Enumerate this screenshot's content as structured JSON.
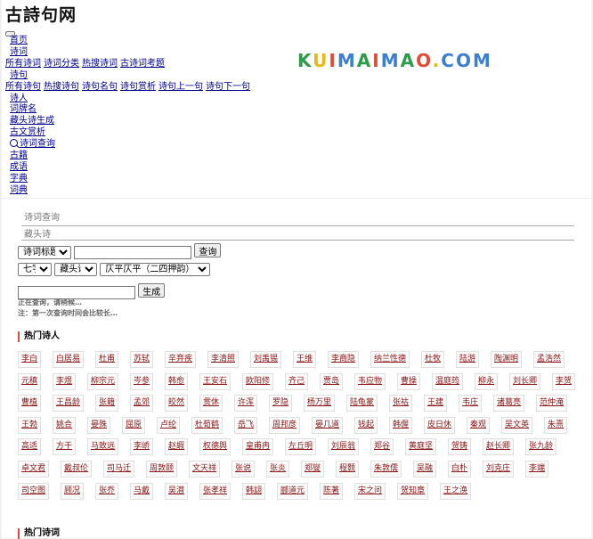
{
  "site": {
    "logo_text": "古詩句网",
    "brand": {
      "k": "K",
      "u": "U",
      "i": "I",
      "m": "M",
      "a": "A",
      "o": "O",
      "dot": ".",
      "com": "COM"
    }
  },
  "nav": {
    "home": "首页",
    "poems": "诗词",
    "poem_sub": [
      "所有诗词",
      "诗词分类",
      "热搜诗词",
      "古诗词考题"
    ],
    "lines": "诗句",
    "lines_sub": [
      "所有诗句",
      "热搜诗句",
      "诗句名句",
      "诗句赏析",
      "诗句上一句",
      "诗句下一句"
    ],
    "items": [
      "诗人",
      "词牌名",
      "藏头诗生成",
      "古文赏析"
    ],
    "search": "诗词查询",
    "items2": [
      "古籍",
      "成语",
      "字典",
      "词典"
    ]
  },
  "tabs": [
    "诗词查询",
    "藏头诗"
  ],
  "search": {
    "field_select": "诗词标题",
    "query_value": "",
    "query_button": "查询"
  },
  "acrostic": {
    "length_select": "七字",
    "type_select": "藏头诗",
    "rhyme_select": "仄平仄平（二四押韵）",
    "input_value": "",
    "generate_button": "生成",
    "status": "正在查询，请稍候…",
    "note": "注：第一次查询时间会比较长…"
  },
  "hot_poets_title": "热门诗人",
  "hot_poems_title": "热门诗词",
  "poets": [
    [
      "李白",
      "白居易",
      "杜甫",
      "苏轼",
      "辛弃疾",
      "李清照",
      "刘禹锡",
      "王维",
      "李商隐",
      "纳兰性德",
      "杜牧",
      "陆游",
      "陶渊明",
      "孟浩然"
    ],
    [
      "元稹",
      "李煜",
      "柳宗元",
      "岑参",
      "韩愈",
      "王安石",
      "欧阳修",
      "齐己",
      "贾岛",
      "韦应物",
      "曹操",
      "温庭筠",
      "柳永",
      "刘长卿",
      "李贺"
    ],
    [
      "曹植",
      "王昌龄",
      "张籍",
      "孟郊",
      "皎然",
      "贯休",
      "许浑",
      "罗隐",
      "杨万里",
      "陆龟蒙",
      "张祜",
      "王建",
      "韦庄",
      "诸葛亮",
      "范仲淹"
    ],
    [
      "王勃",
      "姚合",
      "晏殊",
      "屈原",
      "卢纶",
      "杜荀鹤",
      "岳飞",
      "周邦彦",
      "晏几道",
      "钱起",
      "韩偓",
      "皮日休",
      "秦观",
      "吴文英",
      "朱熹"
    ],
    [
      "高适",
      "方干",
      "马致远",
      "李峤",
      "赵嘏",
      "权德舆",
      "皇甫冉",
      "左丘明",
      "刘辰翁",
      "郑谷",
      "黄庭坚",
      "贺铸",
      "赵长卿",
      "张九龄"
    ],
    [
      "卓文君",
      "戴叔伦",
      "司马迁",
      "周敦颐",
      "文天祥",
      "张说",
      "张炎",
      "郑燮",
      "程颢",
      "朱敦儒",
      "吴融",
      "白朴",
      "刘克庄",
      "李端"
    ],
    [
      "司空图",
      "顾况",
      "张乔",
      "马戴",
      "吴潜",
      "张孝祥",
      "韩翃",
      "郦道元",
      "陈著",
      "宋之问",
      "贺知章",
      "王之涣"
    ]
  ]
}
